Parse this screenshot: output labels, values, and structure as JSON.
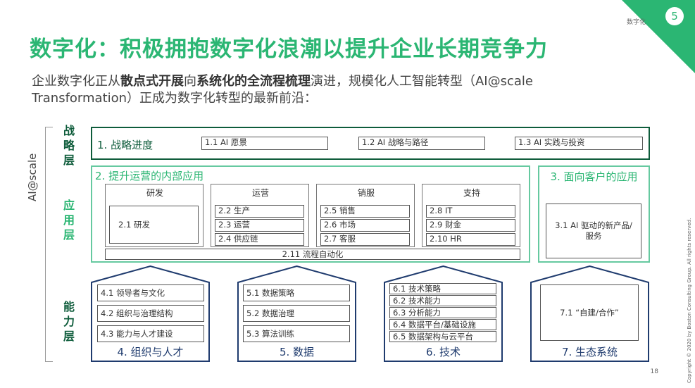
{
  "section_label": "数字化",
  "section_number": "5",
  "title": "数字化：积极拥抱数字化浪潮以提升企业长期竞争力",
  "subtitle": {
    "p1": "企业数字化正从",
    "b1": "散点式开展",
    "p2": "向",
    "b2": "系统化的全流程梳理",
    "p3": "演进，规模化人工智能转型（AI@scale Transformation）正成为数字化转型的最新前沿："
  },
  "side_label": "AI@scale",
  "layers": {
    "strategy": [
      "战",
      "略",
      "层"
    ],
    "application": [
      "应",
      "用",
      "层"
    ],
    "capability": [
      "能",
      "力",
      "层"
    ]
  },
  "strategy": {
    "title": "1. 战略进度",
    "items": [
      "1.1 AI 愿景",
      "1.2 AI 战略与路径",
      "1.3 AI 实践与投资"
    ]
  },
  "internal": {
    "title": "2. 提升运营的内部应用",
    "columns": [
      {
        "header": "研发",
        "items": [
          "2.1 研发"
        ]
      },
      {
        "header": "运营",
        "items": [
          "2.2 生产",
          "2.3 运营",
          "2.4 供应链"
        ]
      },
      {
        "header": "销服",
        "items": [
          "2.5 销售",
          "2.6 市场",
          "2.7 客服"
        ]
      },
      {
        "header": "支持",
        "items": [
          "2.8 IT",
          "2.9 财金",
          "2.10 HR"
        ]
      }
    ],
    "automation": "2.11 流程自动化"
  },
  "customer": {
    "title": "3. 面向客户的应用",
    "item": "3.1 AI 驱动的新产品/服务"
  },
  "capabilities": [
    {
      "name": "4. 组织与人才",
      "items": [
        "4.1 领导者与文化",
        "4.2 组织与治理结构",
        "4.3 能力与人才建设"
      ]
    },
    {
      "name": "5. 数据",
      "items": [
        "5.1 数据策略",
        "5.2 数据治理",
        "5.3 算法训练"
      ]
    },
    {
      "name": "6. 技术",
      "items": [
        "6.1 技术策略",
        "6.2 技术能力",
        "6.3 分析能力",
        "6.4 数据平台/基础设施",
        "6.5 数据架构与云平台"
      ]
    },
    {
      "name": "7. 生态系统",
      "items": [
        "7.1 “自建/合作”"
      ]
    }
  ],
  "page_number": "18",
  "copyright": "Copyright © 2020 by Boston Consulting Group. All rights reserved.",
  "colors": {
    "brand_green": "#2bb673",
    "dark_green": "#0e5c3b",
    "navy": "#1f3b6e"
  }
}
